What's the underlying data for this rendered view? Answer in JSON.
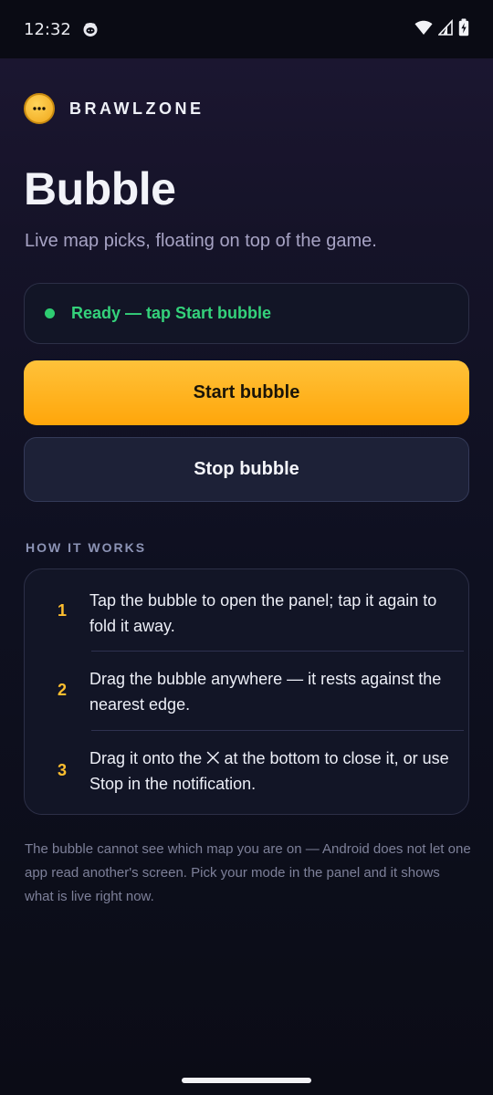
{
  "status_bar": {
    "time": "12:32",
    "app_icon": "octocat-icon",
    "icons": [
      "wifi-icon",
      "cell-signal-icon",
      "battery-charging-icon"
    ]
  },
  "brand": {
    "logo_icon": "chat-bubble-logo-icon",
    "name": "BRAWLZONE"
  },
  "header": {
    "title": "Bubble",
    "subtitle": "Live map picks, floating on top of the game."
  },
  "status": {
    "text": "Ready — tap Start bubble",
    "dot_color": "#2ecc71"
  },
  "buttons": {
    "start_label": "Start bubble",
    "stop_label": "Stop bubble",
    "accent": "#ffae1a"
  },
  "how_it_works": {
    "label": "HOW IT WORKS",
    "steps": [
      {
        "num": "1",
        "text": "Tap the bubble to open the panel; tap it again to fold it away."
      },
      {
        "num": "2",
        "text": "Drag the bubble anywhere — it rests against the nearest edge."
      },
      {
        "num": "3",
        "text": "Drag it onto the ⨉ at the bottom to close it, or use Stop in the notification."
      }
    ]
  },
  "footer_note": "The bubble cannot see which map you are on — Android does not let one app read another's screen. Pick your mode in the panel and it shows what is live right now."
}
